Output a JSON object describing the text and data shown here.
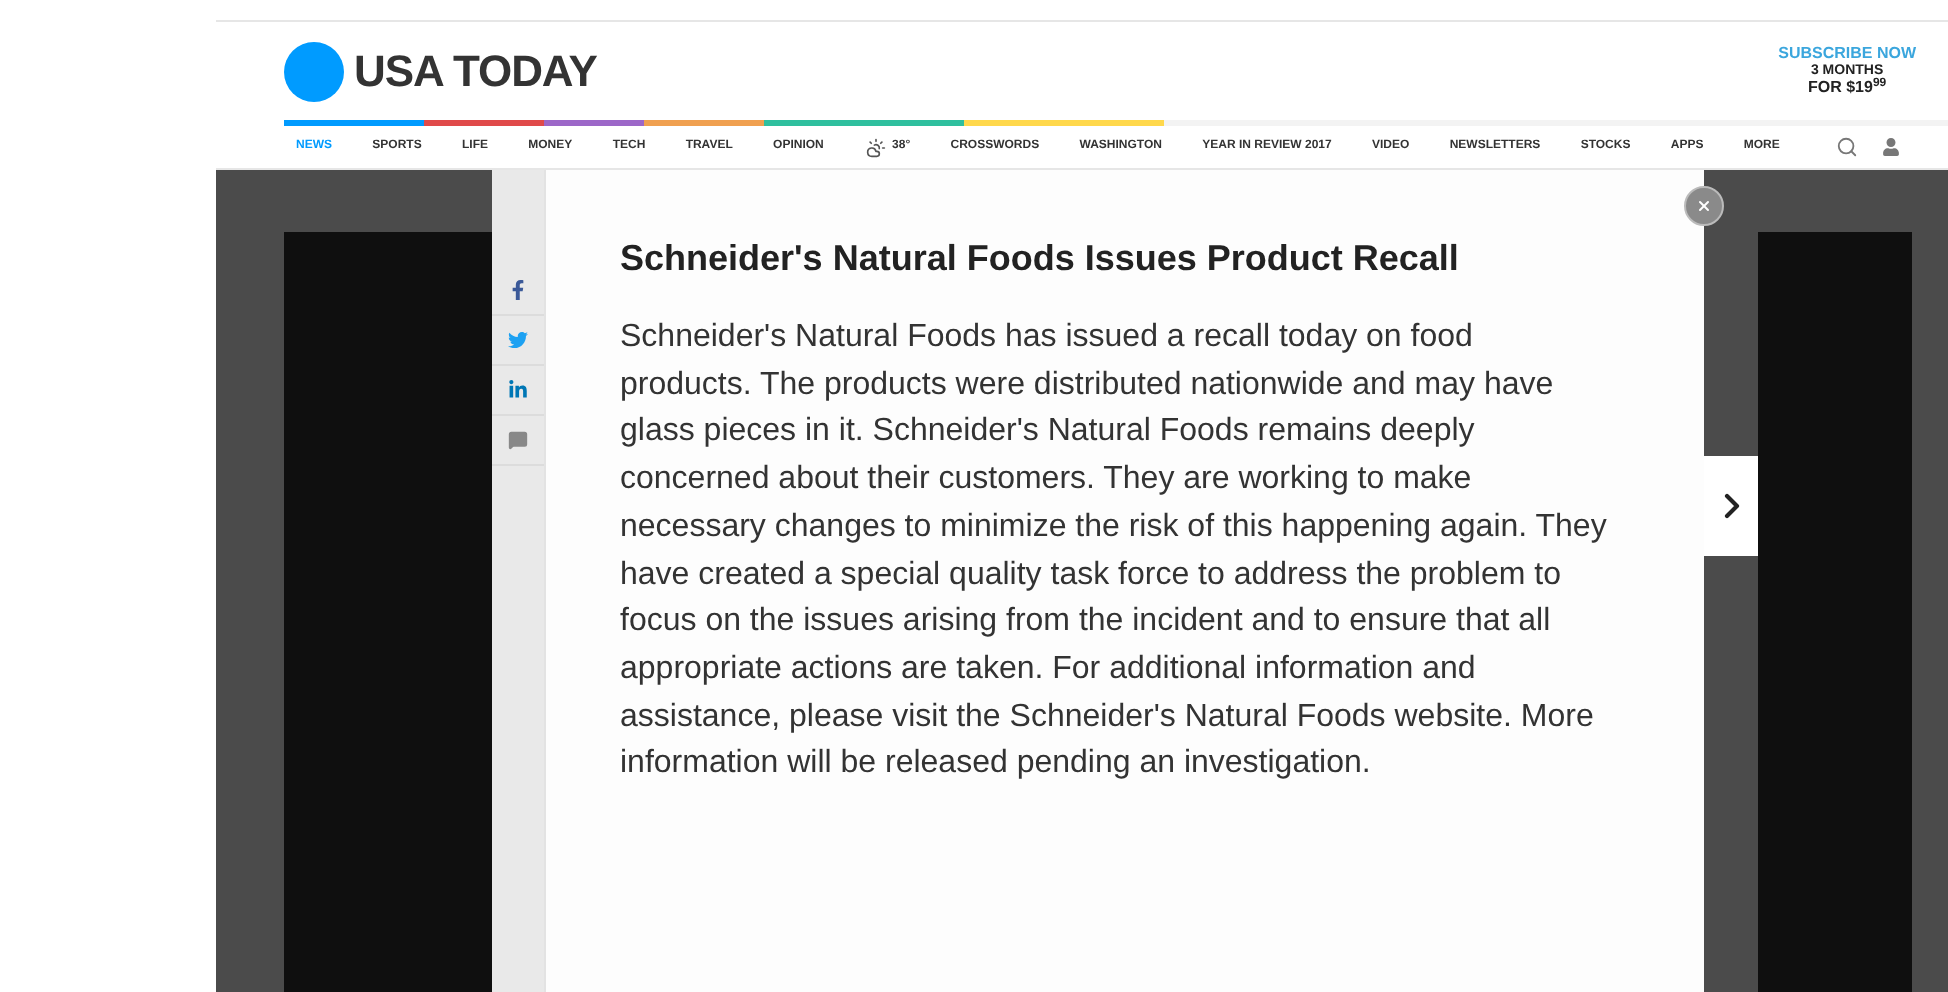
{
  "logo": {
    "text": "USA TODAY"
  },
  "subscribe": {
    "title": "SUBSCRIBE NOW",
    "line_1": "3 MONTHS",
    "line_2": "FOR $19$^{99}$"
  },
  "nav": [
    {
      "label": "NEWS",
      "selected": true
    },
    {
      "label": "SPORTS",
      "selected": false
    },
    {
      "label": "LIFE",
      "selected": false
    },
    {
      "label": "MONEY",
      "selected": false
    },
    {
      "label": "TECH",
      "selected": false
    },
    {
      "label": "TRAVEL",
      "selected": false
    },
    {
      "label": "OPINION",
      "selected": false
    },
    {
      "label": "38°",
      "selected": false,
      "kind": "weather"
    },
    {
      "label": "CROSSWORDS",
      "selected": false
    },
    {
      "label": "WASHINGTON",
      "selected": false
    },
    {
      "label": "YEAR IN REVIEW 2017",
      "selected": false
    },
    {
      "label": "VIDEO",
      "selected": false
    },
    {
      "label": "NEWSLETTERS",
      "selected": false
    },
    {
      "label": "STOCKS",
      "selected": false
    },
    {
      "label": "APPS",
      "selected": false
    },
    {
      "label": "MORE",
      "selected": false
    }
  ],
  "share": [
    {
      "kind": "facebook"
    },
    {
      "kind": "twitter"
    },
    {
      "kind": "linkedin"
    },
    {
      "kind": "comment"
    }
  ],
  "article": {
    "title": "Schneider's Natural Foods Issues Product Recall",
    "body": "Schneider's Natural Foods has issued a recall today on food products. The products were distributed nationwide and may have glass pieces in it. Schneider's Natural Foods remains deeply concerned about their customers. They are working to make necessary changes to minimize the risk of this happening again. They have created a special quality task force to address the problem to focus on the issues arising from the incident and to ensure that all appropriate actions are taken. For additional information and assistance, please visit the Schneider's Natural Foods website. More information will be released pending an investigation."
  }
}
